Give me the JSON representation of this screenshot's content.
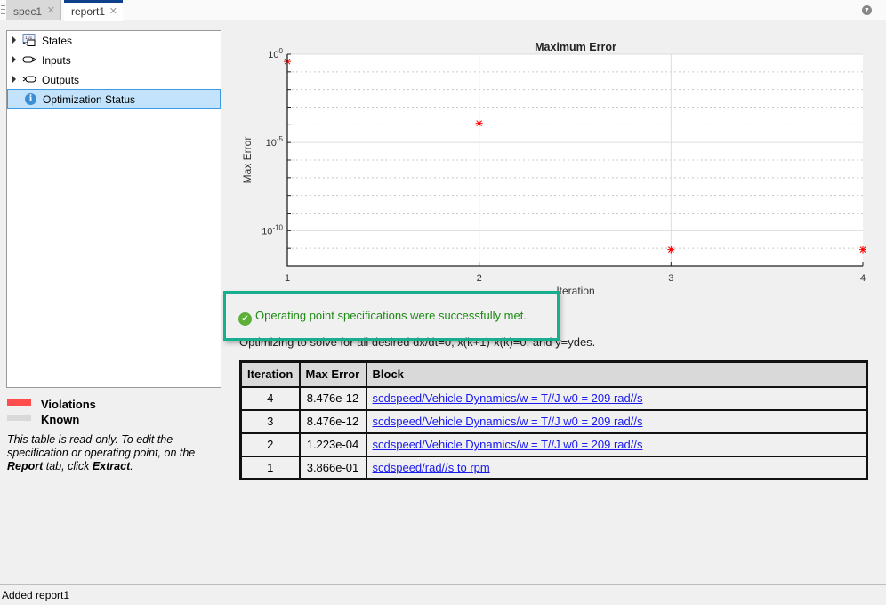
{
  "tabs": [
    {
      "label": "spec1",
      "active": false
    },
    {
      "label": "report1",
      "active": true
    }
  ],
  "tree": {
    "items": [
      {
        "label": "States"
      },
      {
        "label": "Inputs"
      },
      {
        "label": "Outputs"
      },
      {
        "label": "Optimization Status",
        "selected": true
      }
    ]
  },
  "legend": {
    "violations": "Violations",
    "known": "Known",
    "violations_color": "#ff4d4d",
    "known_color": "#d9d9d9"
  },
  "note": {
    "part1": "This table is read-only. To edit the specification or operating point, on the ",
    "report": "Report",
    "part2": " tab, click ",
    "extract": "Extract",
    "part3": "."
  },
  "chart_data": {
    "type": "scatter",
    "title": "Maximum Error",
    "xlabel": "Iteration",
    "ylabel": "Max Error",
    "yscale": "log",
    "xlim": [
      1,
      4
    ],
    "ylim": [
      1e-12,
      1
    ],
    "xticks": [
      "1",
      "2",
      "3",
      "4"
    ],
    "yticks": [
      {
        "base": "10",
        "exp": "0",
        "value": 1
      },
      {
        "base": "10",
        "exp": "-5",
        "value": 1e-05
      },
      {
        "base": "10",
        "exp": "-10",
        "value": 1e-10
      }
    ],
    "x": [
      1,
      2,
      3,
      4
    ],
    "y": [
      0.3866,
      0.0001223,
      8.476e-12,
      8.476e-12
    ],
    "marker": "*",
    "color": "#ff0000",
    "grid": true
  },
  "message": {
    "success": "Operating point specifications were successfully met.",
    "description": "Optimizing to solve for all desired dx/dt=0, x(k+1)-x(k)=0, and y=ydes."
  },
  "table": {
    "headers": [
      "Iteration",
      "Max Error",
      "Block"
    ],
    "rows": [
      {
        "iteration": "4",
        "max_error": "8.476e-12",
        "block": "scdspeed/Vehicle Dynamics/w = T//J w0 = 209 rad//s"
      },
      {
        "iteration": "3",
        "max_error": "8.476e-12",
        "block": "scdspeed/Vehicle Dynamics/w = T//J w0 = 209 rad//s"
      },
      {
        "iteration": "2",
        "max_error": "1.223e-04",
        "block": "scdspeed/Vehicle Dynamics/w = T//J w0 = 209 rad//s"
      },
      {
        "iteration": "1",
        "max_error": "3.866e-01",
        "block": "scdspeed/rad//s to rpm"
      }
    ]
  },
  "status": "Added report1"
}
